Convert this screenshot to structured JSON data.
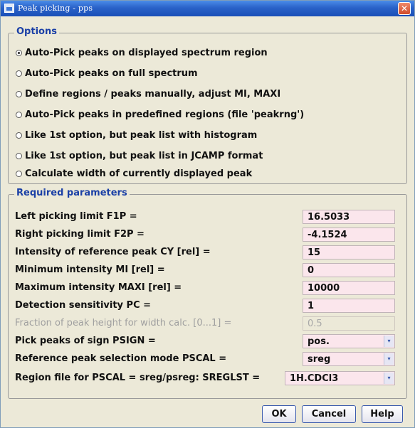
{
  "window": {
    "title": "Peak picking - pps",
    "close_glyph": "✕"
  },
  "options": {
    "group_title": "Options",
    "items": [
      {
        "label": "Auto-Pick peaks on displayed spectrum region",
        "checked": true
      },
      {
        "label": "Auto-Pick peaks on full spectrum",
        "checked": false
      },
      {
        "label": "Define regions / peaks manually, adjust MI, MAXI",
        "checked": false
      },
      {
        "label": "Auto-Pick peaks in predefined regions (file 'peakrng')",
        "checked": false
      },
      {
        "label": "Like 1st option, but peak list with histogram",
        "checked": false
      },
      {
        "label": "Like 1st option, but peak list in JCAMP format",
        "checked": false
      },
      {
        "label": "Calculate width of currently displayed peak",
        "checked": false
      }
    ]
  },
  "params": {
    "group_title": "Required parameters",
    "rows": [
      {
        "label": "Left picking limit F1P =",
        "value": "16.5033"
      },
      {
        "label": "Right picking limit F2P =",
        "value": "-4.1524"
      },
      {
        "label": "Intensity of reference peak CY [rel] =",
        "value": "15"
      },
      {
        "label": "Minimum intensity MI [rel] =",
        "value": "0"
      },
      {
        "label": "Maximum intensity MAXI [rel] =",
        "value": "10000"
      },
      {
        "label": "Detection sensitivity PC =",
        "value": "1"
      },
      {
        "label": "Fraction of peak height for width calc. [0...1] =",
        "value": "0.5"
      },
      {
        "label": "Pick peaks of sign PSIGN =",
        "value": "pos."
      },
      {
        "label": "Reference peak selection mode PSCAL =",
        "value": "sreg"
      },
      {
        "label": "Region file for PSCAL = sreg/psreg: SREGLST =",
        "value": "1H.CDCl3"
      }
    ],
    "dropdown_arrow": "▾"
  },
  "buttons": {
    "ok": "OK",
    "cancel": "Cancel",
    "help": "Help"
  },
  "colors": {
    "group_title": "#1a3fa6",
    "field_bg": "#fbe6ec",
    "titlebar": "#2a62c8"
  }
}
